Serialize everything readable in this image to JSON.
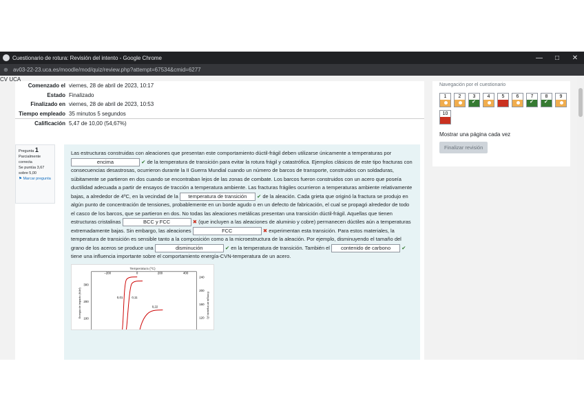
{
  "window": {
    "title": "Cuestionario de rotura: Revisión del intento - Google Chrome",
    "minimize": "—",
    "maximize": "□",
    "close": "✕"
  },
  "address": {
    "url": "av03-22-23.uca.es/moodle/mod/quiz/review.php?attempt=67534&cmid=6277"
  },
  "course_label": "CV UCA",
  "summary": {
    "rows": [
      {
        "k": "Comenzado el",
        "v": "viernes, 28 de abril de 2023, 10:17"
      },
      {
        "k": "Estado",
        "v": "Finalizado"
      },
      {
        "k": "Finalizado en",
        "v": "viernes, 28 de abril de 2023, 10:53"
      },
      {
        "k": "Tiempo empleado",
        "v": "35 minutos 5 segundos"
      },
      {
        "k": "Calificación",
        "v": "5,47 de 10,00 (54,67%)"
      }
    ]
  },
  "question": {
    "label": "Pregunta",
    "number": "1",
    "state": "Parcialmente correcta",
    "score": "Se puntúa 3,67 sobre 5,00",
    "flag": "Marcar pregunta",
    "p1": "Las estructuras construidas con aleaciones que presentan este comportamiento dúctil-frágil deben utilizarse únicamente a temperaturas por",
    "b1": "encima",
    "p2": "de la temperatura de transición para evitar la rotura frágil y catastrófica. Ejemplos clásicos de este tipo fracturas con consecuencias desastrosas, ocurrieron durante la II Guerra Mundial cuando un número de barcos de transporte, construidos con soldaduras, súbitamente se partieron en dos cuando se encontraban lejos de las zonas de combate. Los barcos fueron construidos con un acero que poseía ductilidad adecuada a partir de ensayos de tracción a temperatura ambiente. Las fracturas frágiles ocurrieron a temperaturas ambiente relativamente bajas, a alrededor de 4ºC, en la vecindad de la",
    "b2": "temperatura de transición",
    "p3": "de la aleación. Cada grieta que originó la fractura se produjo en algún punto de concentración de tensiones, probablemente en un borde agudo o en un defecto de fabricación, el cual se propagó alrededor de todo el casco de los barcos, que se partieron en dos. No todas las aleaciones metálicas presentan una transición dúctil-frágil. Aquellas que tienen estructuras cristalinas",
    "b3": "BCC y FCC",
    "p4": "(que incluyen a las aleaciones de aluminio y cobre) permanecen dúctiles aún a temperaturas extremadamente bajas. Sin embargo, las aleaciones",
    "b4": "FCC",
    "p5": "experimentan esta transición. Para estos materiales, la temperatura de transición es sensible tanto a la composición como a la microestructura de la aleación. Por ejemplo, disminuyendo el tamaño del grano de los aceros se produce una",
    "b5": "disminución",
    "p6": "en la temperatura de transición. También el",
    "b6": "contenido de carbono",
    "p7": "tiene una influencia importante sobre el comportamiento energía-CVN-temperatura de un acero.",
    "check": "✔",
    "cross": "✖"
  },
  "graph": {
    "top_label": "Temperatura (ºC)",
    "top_ticks": [
      "−200",
      "0",
      "200",
      "400"
    ],
    "y_ticks": [
      "300",
      "200",
      "100"
    ],
    "right_ticks": [
      "240",
      "200",
      "160",
      "120"
    ],
    "right_label": "Energía de impacto (J)",
    "left_label": "Energía de impacto (ft-lbf)",
    "series_labels": [
      "0,01",
      "0,11",
      "0,22"
    ]
  },
  "nav": {
    "header": "Navegación por el cuestionario",
    "items": [
      {
        "n": "1",
        "s": "o"
      },
      {
        "n": "2",
        "s": "o"
      },
      {
        "n": "3",
        "s": "g"
      },
      {
        "n": "4",
        "s": "o"
      },
      {
        "n": "5",
        "s": "r"
      },
      {
        "n": "6",
        "s": "o"
      },
      {
        "n": "7",
        "s": "g"
      },
      {
        "n": "8",
        "s": "g"
      },
      {
        "n": "9",
        "s": "o"
      },
      {
        "n": "10",
        "s": "r"
      }
    ],
    "show_all": "Mostrar una página cada vez",
    "finish": "Finalizar revisión"
  }
}
